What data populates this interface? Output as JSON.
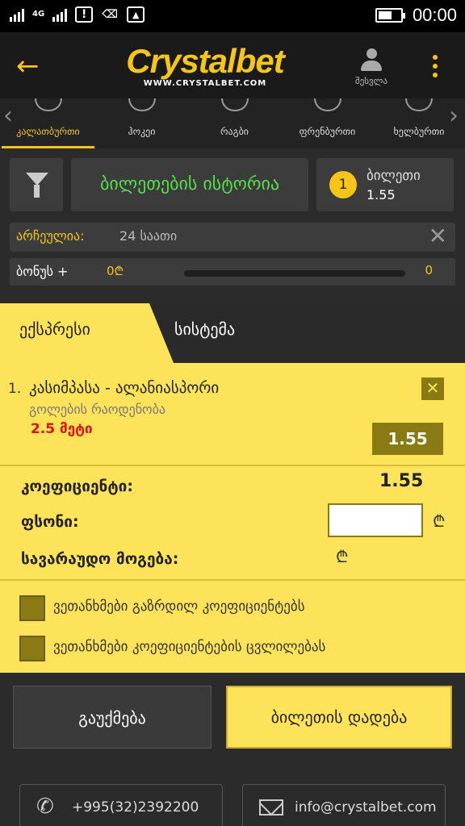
{
  "status_bar": {
    "network": "4G",
    "time": "00:00"
  },
  "header": {
    "logo": "Crystalbet",
    "logo_sub": "WWW.CRYSTALBET.COM",
    "login_label": "შესვლა"
  },
  "sports": [
    {
      "label": "კალათბურთი",
      "active": true
    },
    {
      "label": "ჰოკეი"
    },
    {
      "label": "რაგბი"
    },
    {
      "label": "ფრენბურთი"
    },
    {
      "label": "ხელბურთი"
    }
  ],
  "controls": {
    "history_label": "ბილეთების ისტორია",
    "ticket_count": "1",
    "ticket_label": "ბილეთი",
    "ticket_odd": "1.55"
  },
  "filter": {
    "chosen_label": "არჩეულია:",
    "chosen_value": "24 საათი"
  },
  "bonus": {
    "label": "ბონუს +",
    "amount": "0₾",
    "max": "0",
    "progress": 0
  },
  "slip": {
    "tab_express": "ექსპრესი",
    "tab_system": "სისტემა",
    "bet": {
      "number": "1.",
      "match": "კასიმპასა - ალანიასპორი",
      "market": "გოლების რაოდენობა",
      "pick": "2.5 მეტი",
      "odd": "1.55"
    },
    "coef_label": "კოეფიციენტი:",
    "coef_value": "1.55",
    "stake_label": "ფსონი:",
    "stake_value": "",
    "currency": "₾",
    "win_label": "სავარაუდო მოგება:",
    "check_increase": "ვეთანხმები გაზრდილ კოეფიციენტებს",
    "check_change": "ვეთანხმები კოეფიციენტების ცვლილებას"
  },
  "actions": {
    "cancel": "გაუქმება",
    "place": "ბილეთის დადება"
  },
  "contact": {
    "phone": "+995(32)2392200",
    "email": "info@crystalbet.com"
  },
  "colors": {
    "accent": "#f5c518",
    "slip": "#fde35a",
    "dark": "#2b2b2b"
  }
}
